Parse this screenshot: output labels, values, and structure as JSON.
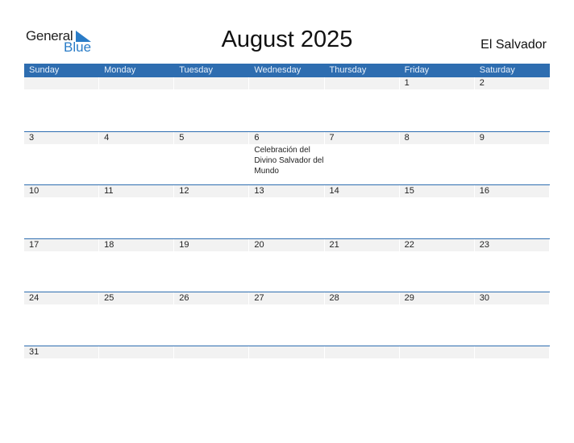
{
  "logo": {
    "line1": "General",
    "line2": "Blue"
  },
  "title": "August 2025",
  "country": "El Salvador",
  "colors": {
    "header_bg": "#2e6db0",
    "accent": "#2a7cc7",
    "day_bg": "#f2f2f2"
  },
  "weekdays": [
    "Sunday",
    "Monday",
    "Tuesday",
    "Wednesday",
    "Thursday",
    "Friday",
    "Saturday"
  ],
  "weeks": [
    [
      {
        "day": ""
      },
      {
        "day": ""
      },
      {
        "day": ""
      },
      {
        "day": ""
      },
      {
        "day": ""
      },
      {
        "day": "1"
      },
      {
        "day": "2"
      }
    ],
    [
      {
        "day": "3"
      },
      {
        "day": "4"
      },
      {
        "day": "5"
      },
      {
        "day": "6",
        "event": "Celebración del Divino Salvador del Mundo"
      },
      {
        "day": "7"
      },
      {
        "day": "8"
      },
      {
        "day": "9"
      }
    ],
    [
      {
        "day": "10"
      },
      {
        "day": "11"
      },
      {
        "day": "12"
      },
      {
        "day": "13"
      },
      {
        "day": "14"
      },
      {
        "day": "15"
      },
      {
        "day": "16"
      }
    ],
    [
      {
        "day": "17"
      },
      {
        "day": "18"
      },
      {
        "day": "19"
      },
      {
        "day": "20"
      },
      {
        "day": "21"
      },
      {
        "day": "22"
      },
      {
        "day": "23"
      }
    ],
    [
      {
        "day": "24"
      },
      {
        "day": "25"
      },
      {
        "day": "26"
      },
      {
        "day": "27"
      },
      {
        "day": "28"
      },
      {
        "day": "29"
      },
      {
        "day": "30"
      }
    ],
    [
      {
        "day": "31"
      },
      {
        "day": ""
      },
      {
        "day": ""
      },
      {
        "day": ""
      },
      {
        "day": ""
      },
      {
        "day": ""
      },
      {
        "day": ""
      }
    ]
  ]
}
